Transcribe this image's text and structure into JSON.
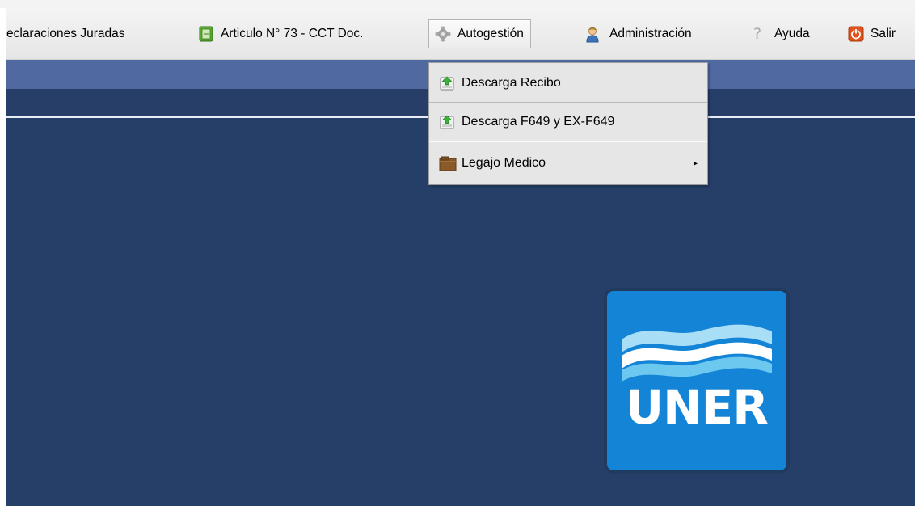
{
  "menubar": {
    "items": [
      {
        "label": "eclaraciones Juradas",
        "icon": "none"
      },
      {
        "label": "Articulo N° 73 - CCT Doc.",
        "icon": "green-book-icon"
      },
      {
        "label": "Autogestión",
        "icon": "gear-icon"
      },
      {
        "label": "Administración",
        "icon": "admin-user-icon"
      },
      {
        "label": "Ayuda",
        "icon": "help-icon"
      },
      {
        "label": "Salir",
        "icon": "power-icon"
      }
    ],
    "active_item": "Autogestión"
  },
  "autogestion_menu": {
    "items": [
      {
        "label": "Descarga Recibo",
        "icon": "download-icon"
      },
      {
        "label": "Descarga F649 y EX-F649",
        "icon": "download-icon"
      },
      {
        "label": "Legajo Medico",
        "icon": "folder-icon",
        "submenu_indicator": "▸"
      }
    ]
  },
  "logo": {
    "text": "UNER"
  },
  "colors": {
    "nav_blue": "#5069a1",
    "main_background": "#263f69",
    "logo_blue": "#1485d6",
    "menu_background": "#e6e6e6"
  }
}
